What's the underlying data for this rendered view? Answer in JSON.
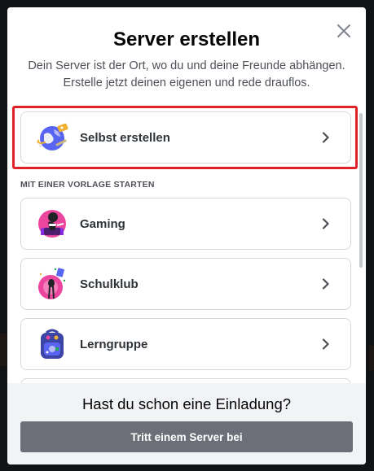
{
  "modal": {
    "title": "Server erstellen",
    "subtitle_line1": "Dein Server ist der Ort, wo du und deine Freunde abhängen.",
    "subtitle_line2": "Erstelle jetzt deinen eigenen und rede drauflos.",
    "close_icon": "close-icon"
  },
  "create_own": {
    "label": "Selbst erstellen",
    "icon": "globe-icon",
    "highlight_color": "#e02128"
  },
  "templates": {
    "header": "MIT EINER VORLAGE STARTEN",
    "items": [
      {
        "label": "Gaming",
        "icon": "gaming-icon"
      },
      {
        "label": "Schulklub",
        "icon": "school-club-icon"
      },
      {
        "label": "Lerngruppe",
        "icon": "study-group-icon"
      }
    ]
  },
  "footer": {
    "title": "Hast du schon eine Einladung?",
    "join_button": "Tritt einem Server bei"
  },
  "colors": {
    "button_gray": "#6d6f78",
    "footer_bg": "#f2f3f5",
    "overlay": "#111214"
  }
}
